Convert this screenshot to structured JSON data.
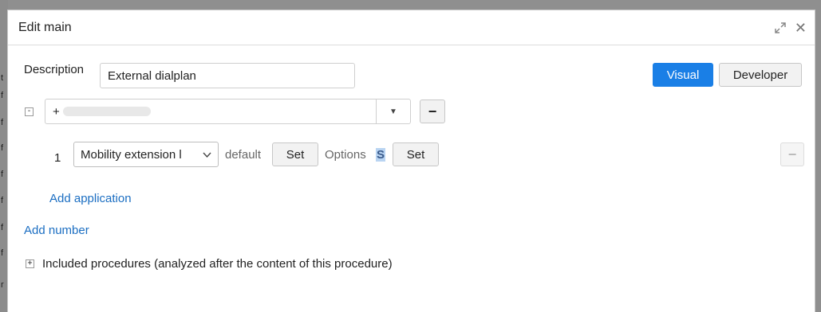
{
  "background": {
    "edge_letters": [
      "t",
      "f",
      "f",
      "f",
      "f",
      "f",
      "f",
      "f",
      "r"
    ]
  },
  "dialog": {
    "title": "Edit main",
    "expand_icon": "expand-icon",
    "close_icon": "close-icon"
  },
  "description": {
    "label": "Description",
    "value": "External dialplan"
  },
  "mode_buttons": {
    "visual": "Visual",
    "developer": "Developer"
  },
  "number": {
    "collapse_symbol": "-",
    "value": "+",
    "dropdown_icon": "caret-down-icon",
    "remove_symbol": "−"
  },
  "application": {
    "index": "1",
    "selected": "Mobility extension l",
    "default_label": "default",
    "set_label": "Set",
    "options_label": "Options",
    "options_value": "S",
    "set2_label": "Set",
    "remove_symbol": "−"
  },
  "links": {
    "add_application": "Add application",
    "add_number": "Add number"
  },
  "included": {
    "expand_symbol": "+",
    "label": "Included procedures (analyzed after the content of this procedure)"
  },
  "colors": {
    "accent": "#1a7fe6",
    "link": "#1b6ec2"
  }
}
